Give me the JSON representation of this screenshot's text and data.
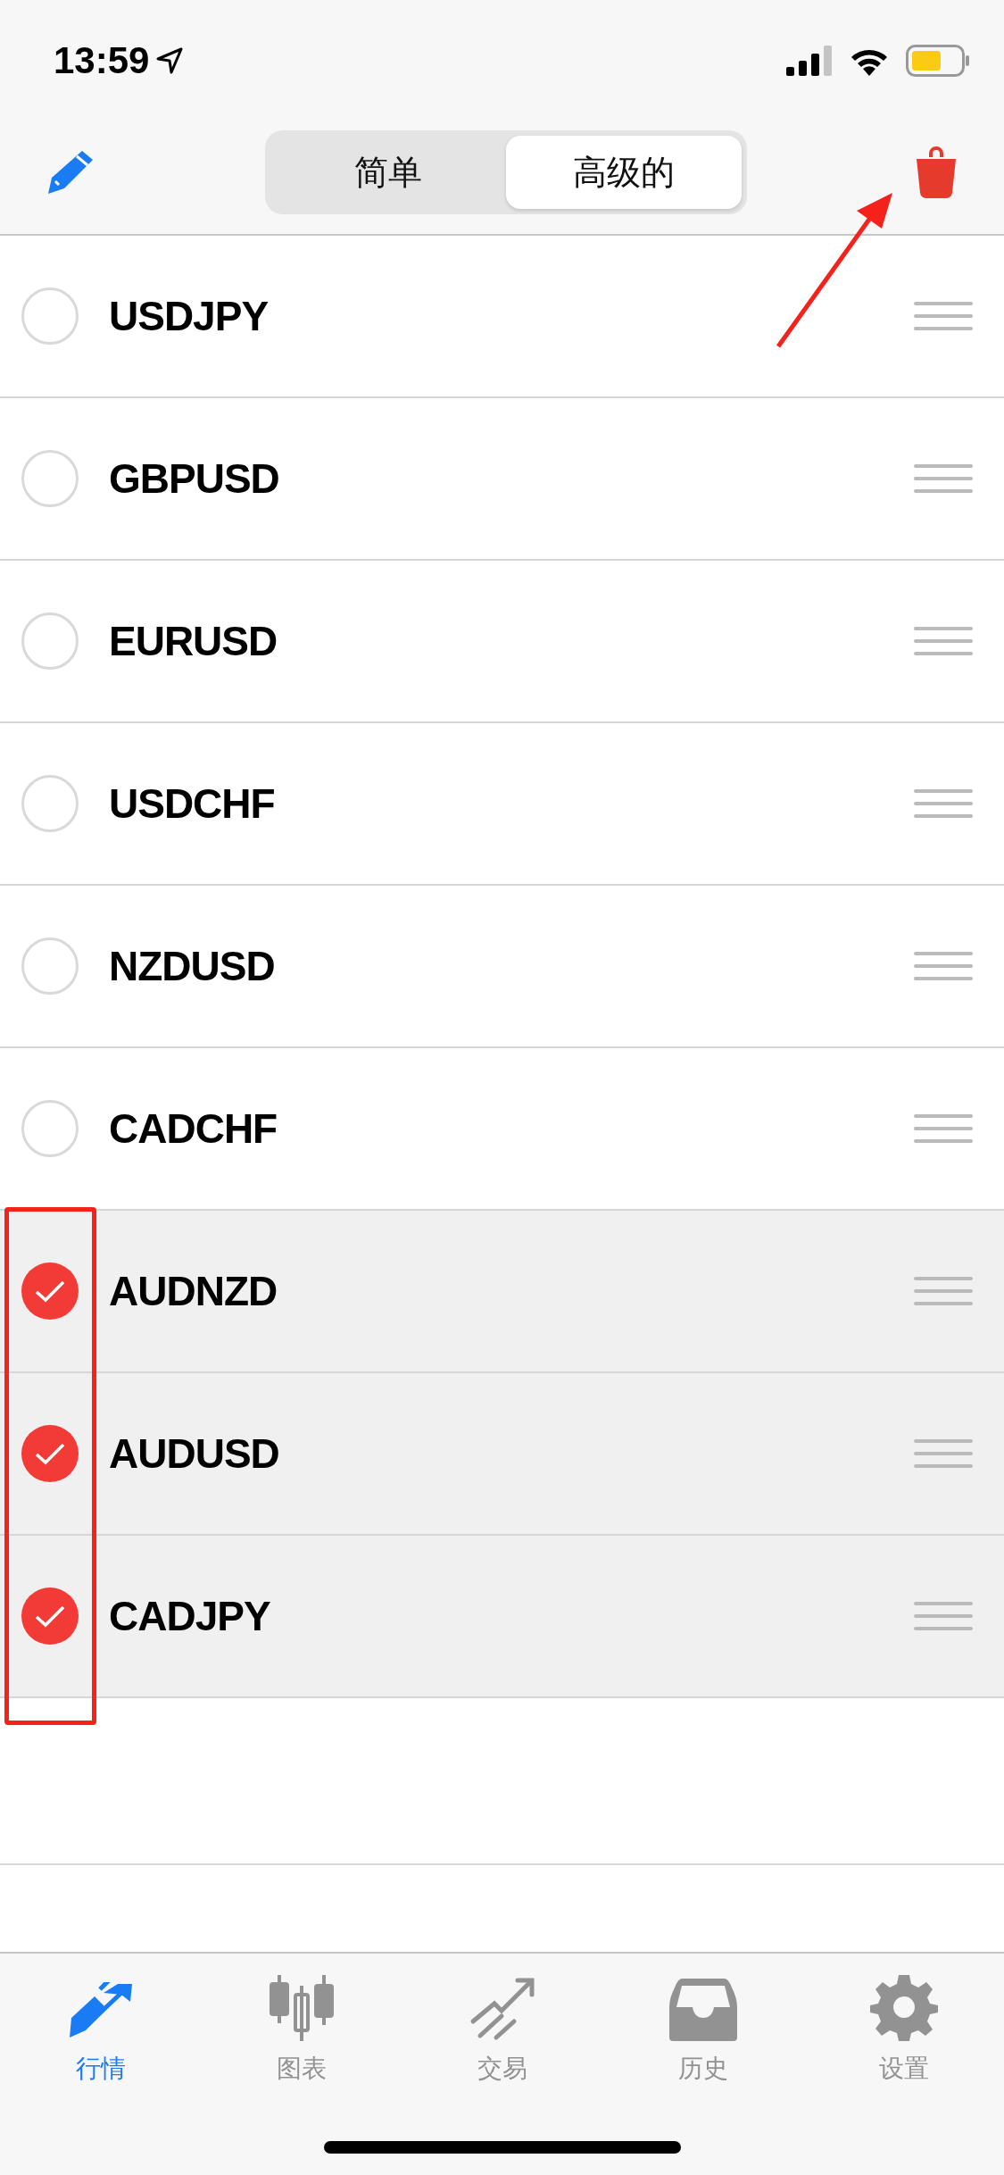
{
  "status_bar": {
    "time": "13:59"
  },
  "nav": {
    "segments": [
      {
        "label": "简单",
        "selected": false
      },
      {
        "label": "高级的",
        "selected": true
      }
    ]
  },
  "rows": [
    {
      "symbol": "USDJPY",
      "selected": false
    },
    {
      "symbol": "GBPUSD",
      "selected": false
    },
    {
      "symbol": "EURUSD",
      "selected": false
    },
    {
      "symbol": "USDCHF",
      "selected": false
    },
    {
      "symbol": "NZDUSD",
      "selected": false
    },
    {
      "symbol": "CADCHF",
      "selected": false
    },
    {
      "symbol": "AUDNZD",
      "selected": true
    },
    {
      "symbol": "AUDUSD",
      "selected": true
    },
    {
      "symbol": "CADJPY",
      "selected": true
    }
  ],
  "tab_bar": [
    {
      "label": "行情",
      "selected": true
    },
    {
      "label": "图表",
      "selected": false
    },
    {
      "label": "交易",
      "selected": false
    },
    {
      "label": "历史",
      "selected": false
    },
    {
      "label": "设置",
      "selected": false
    }
  ]
}
